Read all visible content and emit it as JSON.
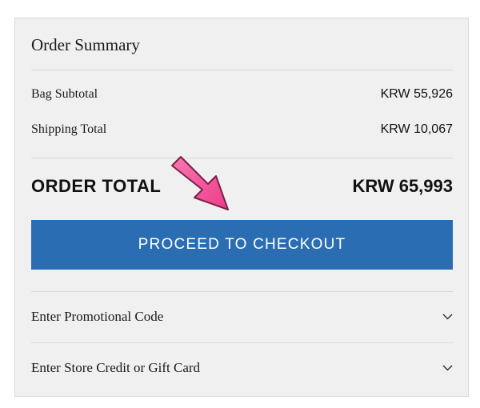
{
  "order_summary": {
    "title": "Order Summary",
    "bag_subtotal": {
      "label": "Bag Subtotal",
      "value": "KRW 55,926"
    },
    "shipping_total": {
      "label": "Shipping Total",
      "value": "KRW 10,067"
    },
    "order_total": {
      "label": "ORDER TOTAL",
      "value": "KRW 65,993"
    },
    "checkout_button": {
      "label": "PROCEED TO CHECKOUT",
      "color": "#2b6db3"
    },
    "promo_code": {
      "label": "Enter Promotional Code",
      "icon": "chevron-down-icon"
    },
    "store_credit": {
      "label": "Enter Store Credit or Gift Card",
      "icon": "chevron-down-icon"
    }
  },
  "annotation": {
    "icon": "pointer-arrow-icon",
    "color": "#f4559a"
  }
}
